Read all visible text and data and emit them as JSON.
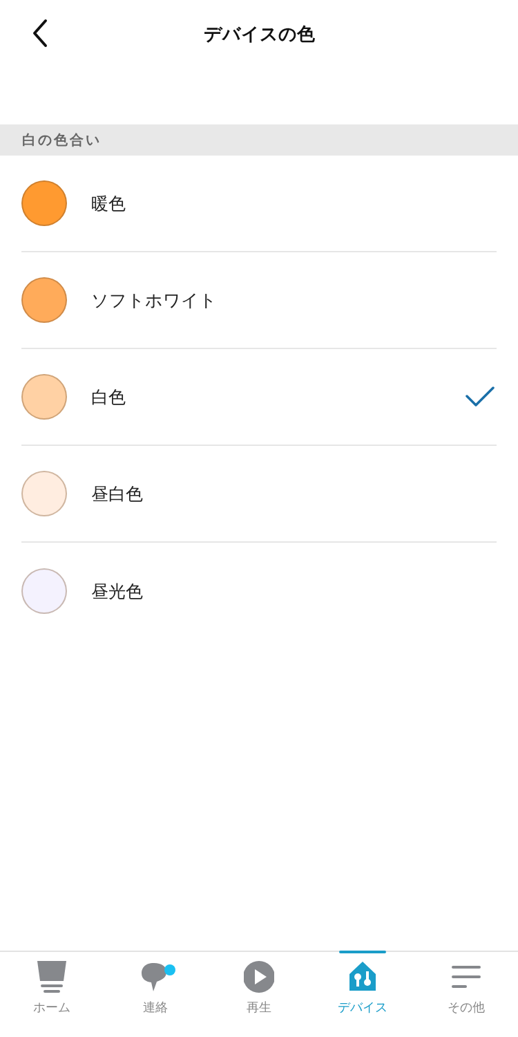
{
  "header": {
    "title": "デバイスの色"
  },
  "section": {
    "title": "白の色合い"
  },
  "colors": [
    {
      "label": "暖色",
      "color": "#ff9a30",
      "selected": false
    },
    {
      "label": "ソフトホワイト",
      "color": "#ffab5a",
      "selected": false
    },
    {
      "label": "白色",
      "color": "#ffd1a4",
      "selected": true
    },
    {
      "label": "昼白色",
      "color": "#ffede0",
      "selected": false
    },
    {
      "label": "昼光色",
      "color": "#f4f2fe",
      "selected": false
    }
  ],
  "tabs": [
    {
      "label": "ホーム",
      "kind": "home",
      "selected": false,
      "badge": false
    },
    {
      "label": "連絡",
      "kind": "chat",
      "selected": false,
      "badge": true
    },
    {
      "label": "再生",
      "kind": "play",
      "selected": false,
      "badge": false
    },
    {
      "label": "デバイス",
      "kind": "devices",
      "selected": true,
      "badge": false
    },
    {
      "label": "その他",
      "kind": "more",
      "selected": false,
      "badge": false
    }
  ]
}
